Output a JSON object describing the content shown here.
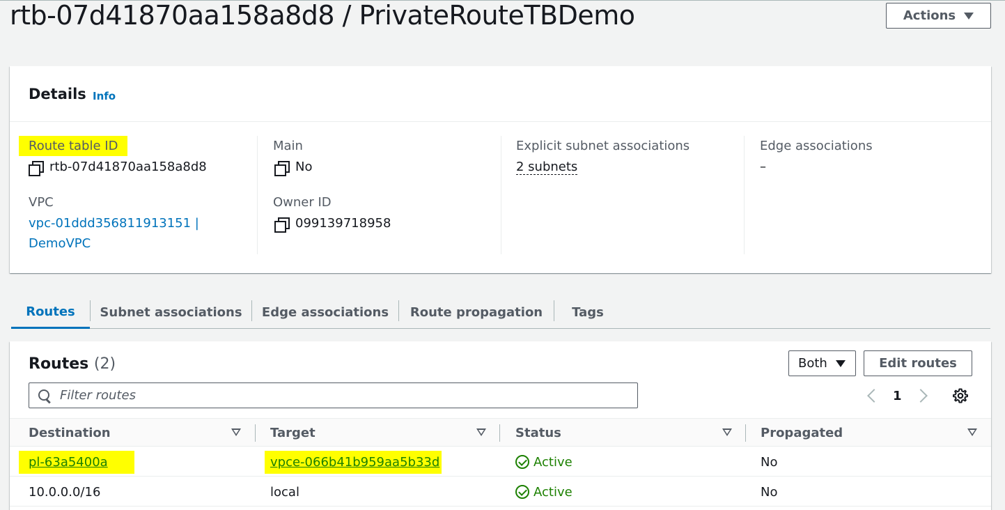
{
  "header": {
    "title": "rtb-07d41870aa158a8d8 / PrivateRouteTBDemo",
    "actions_label": "Actions"
  },
  "details": {
    "title": "Details",
    "info": "Info",
    "route_table_id_label": "Route table ID",
    "route_table_id_value": "rtb-07d41870aa158a8d8",
    "vpc_label": "VPC",
    "vpc_value_line1": "vpc-01ddd356811913151 |",
    "vpc_value_line2": "DemoVPC",
    "main_label": "Main",
    "main_value": "No",
    "owner_label": "Owner ID",
    "owner_value": "099139718958",
    "explicit_label": "Explicit subnet associations",
    "explicit_value": "2 subnets",
    "edge_label": "Edge associations",
    "edge_value": "–"
  },
  "tabs": [
    {
      "label": "Routes",
      "active": true
    },
    {
      "label": "Subnet associations"
    },
    {
      "label": "Edge associations"
    },
    {
      "label": "Route propagation"
    },
    {
      "label": "Tags"
    }
  ],
  "routes": {
    "title": "Routes",
    "count": "(2)",
    "filter_select": "Both",
    "edit_label": "Edit routes",
    "filter_placeholder": "Filter routes",
    "page": "1",
    "columns": [
      "Destination",
      "Target",
      "Status",
      "Propagated"
    ],
    "rows": [
      {
        "destination": "pl-63a5400a",
        "target": "vpce-066b41b959aa5b33d",
        "status": "Active",
        "propagated": "No"
      },
      {
        "destination": "10.0.0.0/16",
        "target": "local",
        "status": "Active",
        "propagated": "No"
      }
    ]
  },
  "colors": {
    "link": "#0073bb",
    "success": "#1d8102",
    "highlight": "#ffff00"
  }
}
